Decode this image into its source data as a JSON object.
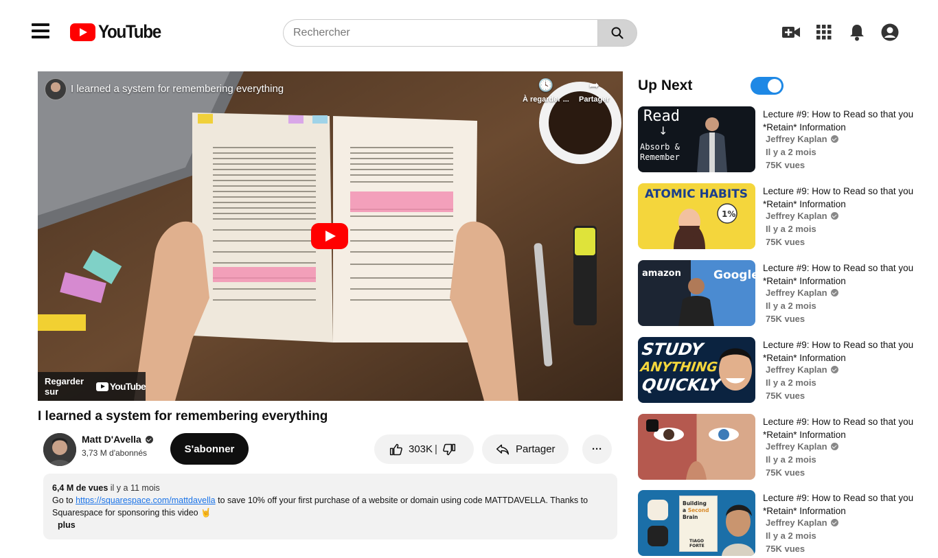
{
  "header": {
    "logo_text": "YouTube",
    "search_placeholder": "Rechercher",
    "icons": [
      "menu-icon",
      "youtube-logo",
      "search-icon",
      "create-video-icon",
      "apps-grid-icon",
      "notifications-bell-icon",
      "account-icon"
    ]
  },
  "player": {
    "title": "I learned a system for remembering everything",
    "watch_later": "À regarder ...",
    "share": "Partager",
    "watch_on": "Regarder sur",
    "watch_on_brand": "YouTube",
    "colors": {
      "play": "#ff0000"
    }
  },
  "video": {
    "title": "I learned a system for remembering everything",
    "channel": "Matt D'Avella",
    "subscribers": "3,73 M d'abonnés",
    "subscribe": "S'abonner",
    "likes": "303K",
    "share": "Partager",
    "more": "···"
  },
  "description": {
    "views": "6,4 M de vues",
    "age": "il y a 11 mois",
    "text_before": "Go to",
    "link": "https://squarespace.com/mattdavella",
    "text_after": "to save 10% off your first purchase of a website or domain using code MATTDAVELLA. Thanks to Squarespace for sponsoring this video 🤘",
    "more": "plus"
  },
  "sidebar": {
    "heading": "Up Next",
    "autoplay": true,
    "accent": "#1e88e5",
    "items": [
      {
        "title": "Lecture #9: How to Read so that you *Retain* Information",
        "channel": "Jeffrey Kaplan",
        "age": "Il y a 2 mois",
        "views": "75K vues",
        "thumb_text": "Read ↓ Absorb & Remember"
      },
      {
        "title": "Lecture #9: How to Read so that you *Retain* Information",
        "channel": "Jeffrey Kaplan",
        "age": "Il y a 2 mois",
        "views": "75K vues",
        "thumb_text": "ATOMIC HABITS"
      },
      {
        "title": "Lecture #9: How to Read so that you *Retain* Information",
        "channel": "Jeffrey Kaplan",
        "age": "Il y a 2 mois",
        "views": "75K vues",
        "thumb_text": "amazon Google"
      },
      {
        "title": "Lecture #9: How to Read so that you *Retain* Information",
        "channel": "Jeffrey Kaplan",
        "age": "Il y a 2 mois",
        "views": "75K vues",
        "thumb_text": "STUDY ANYTHING QUICKLY"
      },
      {
        "title": "Lecture #9: How to Read so that you *Retain* Information",
        "channel": "Jeffrey Kaplan",
        "age": "Il y a 2 mois",
        "views": "75K vues",
        "thumb_text": ""
      },
      {
        "title": "Lecture #9: How to Read so that you *Retain* Information",
        "channel": "Jeffrey Kaplan",
        "age": "Il y a 2 mois",
        "views": "75K vues",
        "thumb_text": "Building a Second Brain TIAGO FORTE"
      }
    ]
  }
}
